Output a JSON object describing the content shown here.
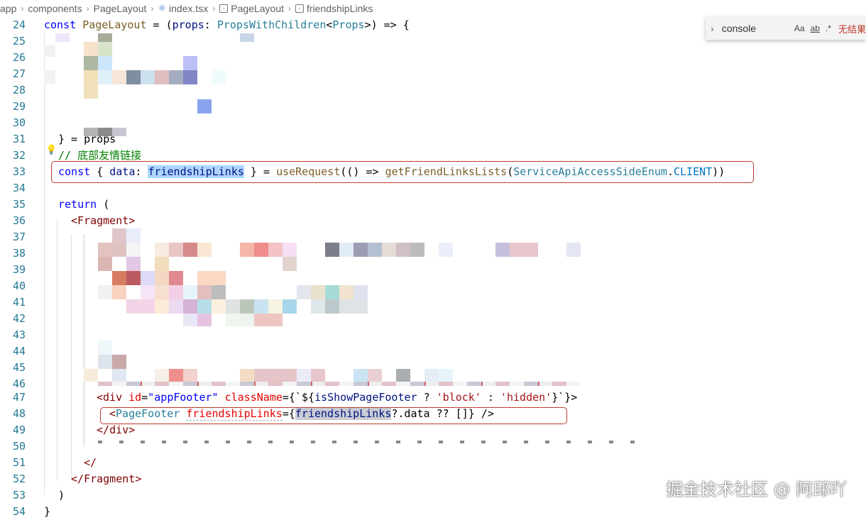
{
  "breadcrumb": {
    "items": [
      "app",
      "components",
      "PageLayout",
      "index.tsx",
      "PageLayout",
      "friendshipLinks"
    ]
  },
  "find_widget": {
    "value": "console",
    "match_case": "Aa",
    "whole_word": "ab",
    "regex": ".*",
    "result": "无结果"
  },
  "editor": {
    "lines": {
      "l24": "24",
      "l25": "25",
      "l26": "26",
      "l27": "27",
      "l28": "28",
      "l29": "29",
      "l30": "30",
      "l31": "31",
      "l32": "32",
      "l33": "33",
      "l34": "34",
      "l35": "35",
      "l36": "36",
      "l37": "37",
      "l38": "38",
      "l39": "39",
      "l40": "40",
      "l41": "41",
      "l42": "42",
      "l43": "43",
      "l44": "44",
      "l45": "45",
      "l46": "46",
      "l47": "47",
      "l48": "48",
      "l49": "49",
      "l50": "50",
      "l51": "51",
      "l52": "52",
      "l53": "53",
      "l54": "54"
    },
    "code": {
      "c24_const": "const",
      "c24_name": "PageLayout",
      "c24_eq": " = (",
      "c24_props": "props",
      "c24_colon": ": ",
      "c24_type": "PropsWithChildren",
      "c24_lt": "<",
      "c24_type2": "Props",
      "c24_rest": ">) => {",
      "c31_text": "} = props",
      "c32_comment": "// 底部友情链接",
      "c33_const": "const",
      "c33_open": " { ",
      "c33_data": "data",
      "c33_colon": ": ",
      "c33_fl": "friendshipLinks",
      "c33_close": " } = ",
      "c33_useRequest": "useRequest",
      "c33_arrow": "(() => ",
      "c33_get": "getFriendLinksLists",
      "c33_paren": "(",
      "c33_enum": "ServiceApiAccessSideEnum",
      "c33_dot": ".",
      "c33_client": "CLIENT",
      "c33_end": "))",
      "c35_return": "return",
      "c35_paren": " (",
      "c36_open": "<",
      "c36_tag": "Fragment",
      "c36_close": ">",
      "c47_open": "<",
      "c47_div": "div",
      "c47_id": "id",
      "c47_eq": "=",
      "c47_idval": "\"appFooter\"",
      "c47_cls": "className",
      "c47_tmpl_open": "={`${",
      "c47_var": "isShowPageFooter",
      "c47_q": " ? ",
      "c47_block": "'block'",
      "c47_colon": " : ",
      "c47_hidden": "'hidden'",
      "c47_end": "}`}>",
      "c48_open": "<",
      "c48_tag": "PageFooter",
      "c48_attr": "friendshipLinks",
      "c48_eq": "={",
      "c48_var": "friendshipLinks",
      "c48_rest": "?.data ?? []} />",
      "c49_close": "</",
      "c49_div": "div",
      "c49_gt": ">",
      "c51_text": "</",
      "c52_close": "</",
      "c52_tag": "Fragment",
      "c52_gt": ">",
      "c53_text": ")",
      "c54_text": "}"
    }
  },
  "watermark": "掘金技术社区 @ 阿邱吖",
  "colors": {
    "keyword": "#0000ff",
    "identifier": "#001080",
    "function": "#795e26",
    "type": "#267f99",
    "string": "#a31515",
    "tag": "#800000",
    "attribute": "#e50000",
    "comment": "#008000",
    "line_number": "#237893",
    "highlight_box": "#c0392b"
  }
}
